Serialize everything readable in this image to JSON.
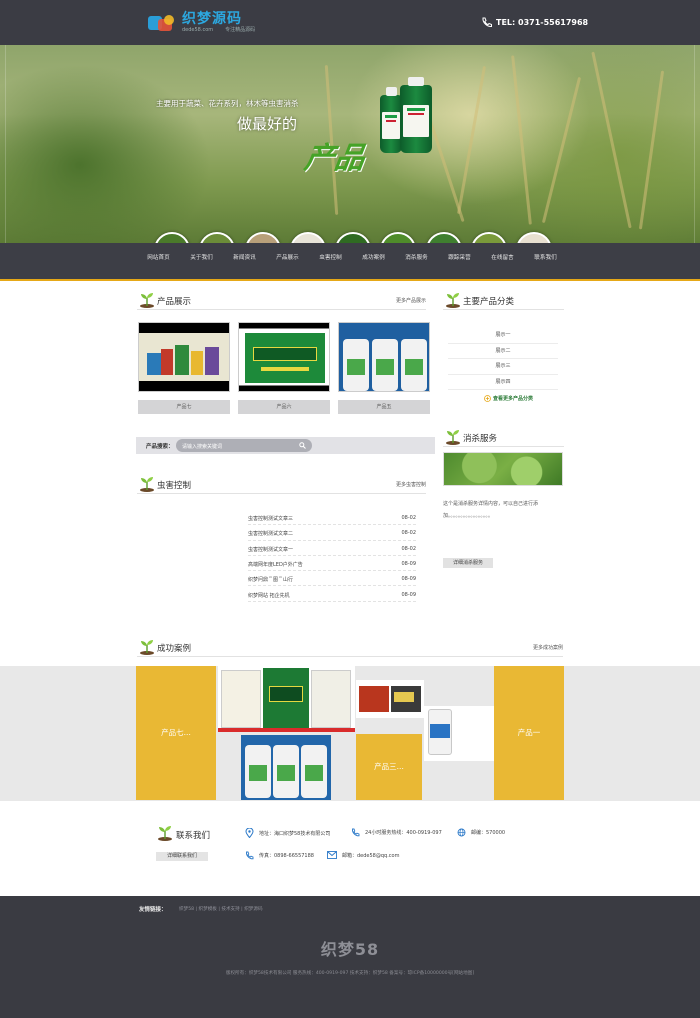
{
  "header": {
    "logo_text": "织梦源码",
    "logo_sub": "dede58.com",
    "logo_tagline": "专注精品源码",
    "phone": "TEL: 0371-55617968"
  },
  "banner": {
    "slogan": "主要用于蔬菜、花卉系列，林木等虫害消杀",
    "headline": "做最好的",
    "headline_big": "产品",
    "active_dot": 1,
    "dot_count": 2
  },
  "nav": [
    "网站首页",
    "关于我们",
    "新闻资讯",
    "产品展示",
    "虫害控制",
    "成功案例",
    "消杀服务",
    "跟踪采营",
    "在线留言",
    "联系我们"
  ],
  "products": {
    "title": "产品展示",
    "more": "更多产品展示",
    "items": [
      {
        "caption": "产品七"
      },
      {
        "caption": "产品六"
      },
      {
        "caption": "产品五"
      }
    ]
  },
  "search": {
    "label": "产品搜索：",
    "placeholder": "请输入搜索关键词"
  },
  "pest": {
    "title": "虫害控制",
    "more": "更多虫害控制",
    "items": [
      {
        "title": "虫害控制测试文章三",
        "date": "08-02"
      },
      {
        "title": "虫害控制测试文章二",
        "date": "08-02"
      },
      {
        "title": "虫害控制测试文章一",
        "date": "08-02"
      },
      {
        "title": "高端网年度LED户外广告",
        "date": "08-09"
      },
      {
        "title": "织梦问鼎＂图＂山行",
        "date": "08-09"
      },
      {
        "title": "织梦网站 拓企先机",
        "date": "08-09"
      }
    ]
  },
  "categories": {
    "title": "主要产品分类",
    "items": [
      "展示一",
      "展示二",
      "展示三",
      "展示四"
    ],
    "more": "查看更多产品分类"
  },
  "service": {
    "title": "消杀服务",
    "desc": "这个是消杀服务详情内容，可以自己进行添加。。。。。。。。。。。。。。。。。",
    "button": "详细消杀服务"
  },
  "cases": {
    "title": "成功案例",
    "more": "更多成功案例",
    "label_left": "产品七...",
    "label_mid": "产品三...",
    "label_right": "产品一"
  },
  "contact": {
    "title": "联系我们",
    "button": "详细联系我们",
    "address": "地址：海口织梦58技术有限公司",
    "hotline": "24小时服务热线：400-0919-097",
    "postcode": "邮编：570000",
    "fax": "传真：0898-66557188",
    "email": "邮箱：dede58@qq.com"
  },
  "footer": {
    "friend_label": "友情链接：",
    "links": "织梦58  |  织梦模板  |  技术支持  |  织梦源码",
    "brand": "织梦58",
    "info": "版权所有：织梦58技术有限公司      服务热线：400-0919-097      技术支持：织梦58      备案号：琼ICP备10000000号[网站地图]"
  },
  "colors": {
    "topbar": "#3b3c44",
    "nav_underline": "#e6a817",
    "accent_yellow": "#e9b834",
    "footer": "#3a3b42"
  }
}
